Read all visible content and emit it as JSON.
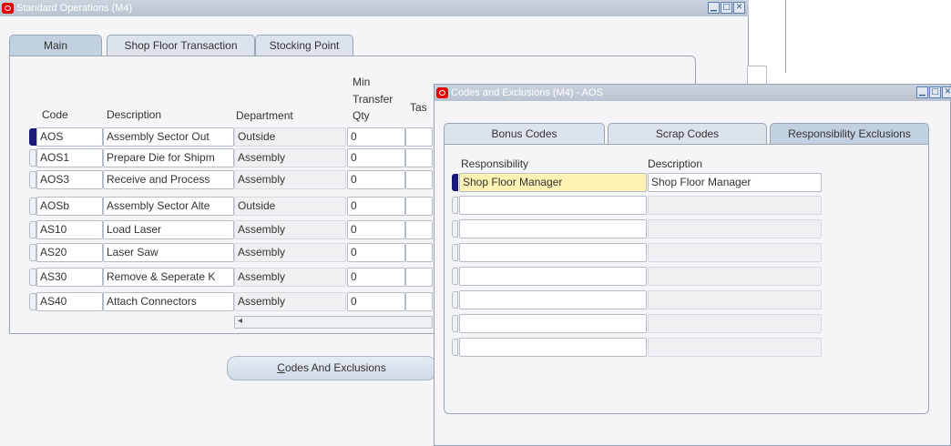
{
  "main_window": {
    "title": "Standard Operations (M4)",
    "tabs": [
      "Main",
      "Shop Floor Transaction",
      "Stocking Point"
    ],
    "active_tab": "Main",
    "columns": {
      "code": "Code",
      "description": "Description",
      "department": "Department",
      "min_qty": [
        "Min",
        "Transfer",
        "Qty"
      ],
      "task_partial": "Tas"
    },
    "rows": [
      {
        "code": "AOS",
        "description": "Assembly Sector Out",
        "department": "Outside",
        "qty": "0"
      },
      {
        "code": "AOS1",
        "description": "Prepare Die for Shipm",
        "department": "Assembly",
        "qty": "0"
      },
      {
        "code": "AOS3",
        "description": "Receive and Process",
        "department": "Assembly",
        "qty": "0"
      },
      {
        "code": "AOSb",
        "description": "Assembly Sector Alte",
        "department": "Outside",
        "qty": "0"
      },
      {
        "code": "AS10",
        "description": "Load Laser",
        "department": "Assembly",
        "qty": "0"
      },
      {
        "code": "AS20",
        "description": "Laser Saw",
        "department": "Assembly",
        "qty": "0"
      },
      {
        "code": "AS30",
        "description": "Remove & Seperate K",
        "department": "Assembly",
        "qty": "0"
      },
      {
        "code": "AS40",
        "description": "Attach Connectors",
        "department": "Assembly",
        "qty": "0"
      }
    ],
    "button_prefix": "C",
    "button_rest": "odes And Exclusions",
    "scroll_left_glyph": "◂"
  },
  "dialog": {
    "title": "Codes and Exclusions (M4) - AOS",
    "tabs": [
      "Bonus Codes",
      "Scrap Codes",
      "Responsibility Exclusions"
    ],
    "active_tab": "Responsibility Exclusions",
    "columns": {
      "responsibility": "Responsibility",
      "description": "Description"
    },
    "rows": [
      {
        "responsibility": "Shop Floor Manager",
        "description": "Shop Floor Manager"
      },
      {
        "responsibility": "",
        "description": ""
      },
      {
        "responsibility": "",
        "description": ""
      },
      {
        "responsibility": "",
        "description": ""
      },
      {
        "responsibility": "",
        "description": ""
      },
      {
        "responsibility": "",
        "description": ""
      },
      {
        "responsibility": "",
        "description": ""
      },
      {
        "responsibility": "",
        "description": ""
      }
    ]
  },
  "window_controls": {
    "minimize": "▁",
    "maximize": "□",
    "close": "✕"
  },
  "colors": {
    "titlebar": "#bcc5d1",
    "oracle_red": "#e80000",
    "selected_field": "#fff2b3",
    "current_record": "#1a1a7a"
  }
}
